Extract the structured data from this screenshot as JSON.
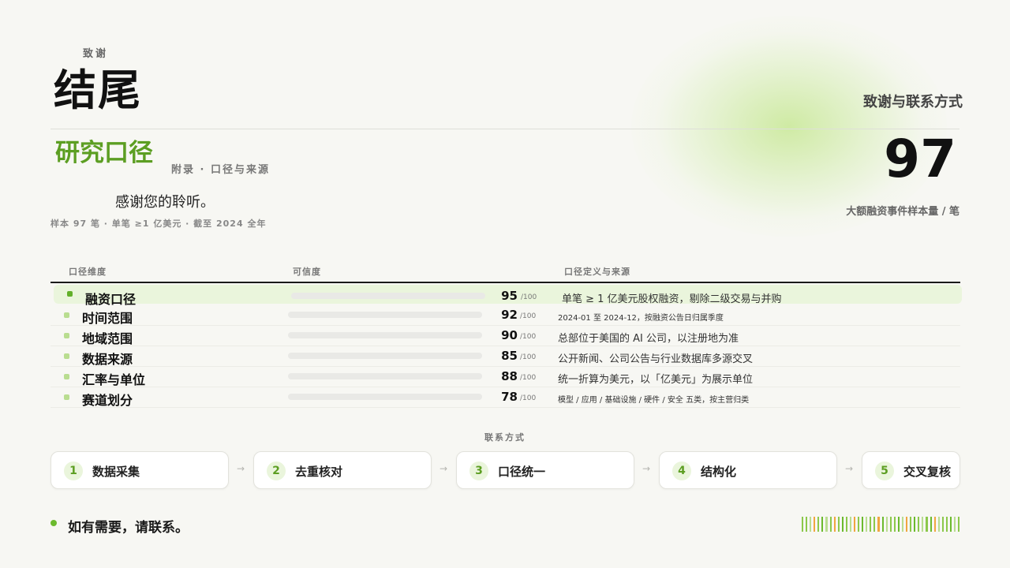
{
  "header": {
    "eyebrow": "致谢",
    "title": "结尾",
    "right_heading": "致谢与联系方式"
  },
  "section": {
    "title": "研究口径",
    "subtitle": "附录 · 口径与来源",
    "thanks": "感谢您的聆听。",
    "meta": "样本 97 笔 · 单笔 ≥1 亿美元 · 截至 2024 全年"
  },
  "kpi": {
    "value": "97",
    "label": "大额融资事件样本量 / 笔"
  },
  "table": {
    "headers": [
      "口径维度",
      "可信度",
      "口径定义与来源"
    ],
    "rows": [
      {
        "name": "融资口径",
        "score": 95,
        "denominator": "/100",
        "definition": "单笔 ≥ 1 亿美元股权融资，剔除二级交易与并购"
      },
      {
        "name": "时间范围",
        "score": 92,
        "denominator": "/100",
        "definition": "2024-01 至 2024-12，按融资公告日归属季度"
      },
      {
        "name": "地域范围",
        "score": 90,
        "denominator": "/100",
        "definition": "总部位于美国的 AI 公司，以注册地为准"
      },
      {
        "name": "数据来源",
        "score": 85,
        "denominator": "/100",
        "definition": "公开新闻、公司公告与行业数据库多源交叉"
      },
      {
        "name": "汇率与单位",
        "score": 88,
        "denominator": "/100",
        "definition": "统一折算为美元，以「亿美元」为展示单位"
      },
      {
        "name": "赛道划分",
        "score": 78,
        "denominator": "/100",
        "definition": "模型 / 应用 / 基础设施 / 硬件 / 安全 五类，按主营归类"
      }
    ]
  },
  "flow": {
    "label": "联系方式",
    "arrow": "→",
    "steps": [
      {
        "num": "1",
        "label": "数据采集"
      },
      {
        "num": "2",
        "label": "去重核对"
      },
      {
        "num": "3",
        "label": "口径统一"
      },
      {
        "num": "4",
        "label": "结构化"
      },
      {
        "num": "5",
        "label": "交叉复核"
      }
    ]
  },
  "footer": {
    "contact": "如有需要，请联系。"
  },
  "colors": {
    "accent": "#5c9e22",
    "highlight_row": "#eaf5dc",
    "barcode": [
      "#8cc84b",
      "#b9dd90",
      "#f0a640",
      "#6cba2e"
    ]
  }
}
